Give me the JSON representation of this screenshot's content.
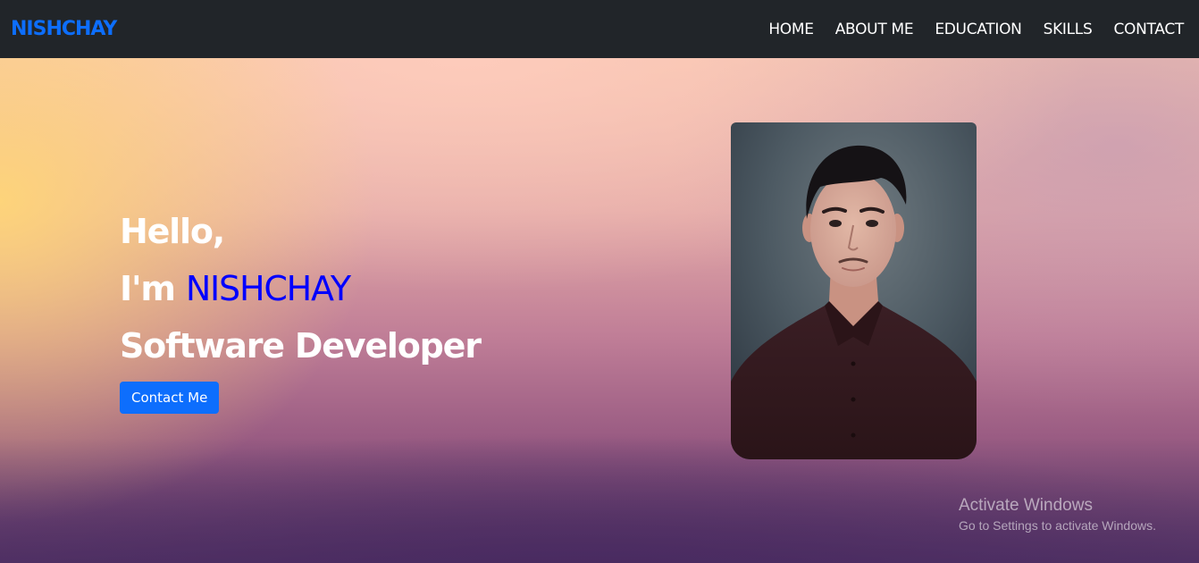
{
  "navbar": {
    "brand": "NISHCHAY",
    "links": [
      {
        "label": "HOME"
      },
      {
        "label": "ABOUT ME"
      },
      {
        "label": "EDUCATION"
      },
      {
        "label": "SKILLS"
      },
      {
        "label": "CONTACT"
      }
    ]
  },
  "hero": {
    "greeting": "Hello,",
    "intro_prefix": "I'm ",
    "name": "NISHCHAY",
    "role": "Software Developer",
    "cta_label": "Contact Me"
  },
  "watermark": {
    "title": "Activate Windows",
    "subtitle": "Go to Settings to activate Windows."
  },
  "colors": {
    "navbar_bg": "#212529",
    "brand": "#0d6efd",
    "name_highlight": "#0000ff",
    "button": "#0d6efd"
  }
}
